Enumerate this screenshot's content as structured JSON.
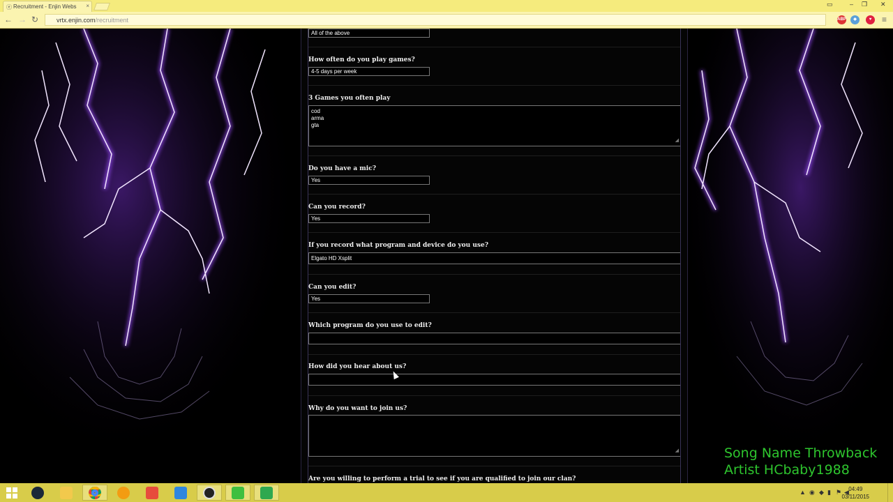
{
  "browser": {
    "tab_title": "Recruitment - Enjin Webs",
    "tab_close": "×",
    "url_host": "vrtx.enjin.com",
    "url_path": "/recruitment",
    "back": "←",
    "forward": "→",
    "reload": "↻",
    "menu": "≡",
    "win_min": "–",
    "win_max": "❐",
    "win_close": "✕"
  },
  "form": {
    "q_prev_value": "All of the above",
    "q_play_often": "How often do you play games?",
    "a_play_often": "4-5 days per week",
    "q_games": "3 Games you often play",
    "a_games": [
      "cod",
      "arma",
      "gta"
    ],
    "q_mic": "Do you have a mic?",
    "a_mic": "Yes",
    "q_record": "Can you record?",
    "a_record": "Yes",
    "q_program_device": "If you record what program and device do you use?",
    "a_program_device": "Elgato HD   Xsplit",
    "q_edit": "Can you edit?",
    "a_edit": "Yes",
    "q_edit_program": "Which program do you use to edit?",
    "a_edit_program": "",
    "q_hear": "How did you hear about us?",
    "a_hear": "",
    "q_why": "Why do you want to join us?",
    "a_why": "",
    "q_trial": "Are you willing to perform a trial to see if you are qualified to join our clan?"
  },
  "overlay": {
    "song": "Song Name Throwback",
    "artist": "Artist HCbaby1988"
  },
  "taskbar": {
    "time": "04:49",
    "date": "03/11/2015",
    "apps": [
      "start",
      "steam",
      "file-explorer",
      "chrome",
      "media-player",
      "paint",
      "windows-media-player",
      "obs",
      "camtasia-recorder",
      "camtasia-studio"
    ]
  },
  "colors": {
    "chrome_yellow": "#f5eb7d",
    "taskbar_yellow": "#d8cc4a",
    "overlay_green": "#2ec52e",
    "lightning_purple": "#9b4dff"
  }
}
